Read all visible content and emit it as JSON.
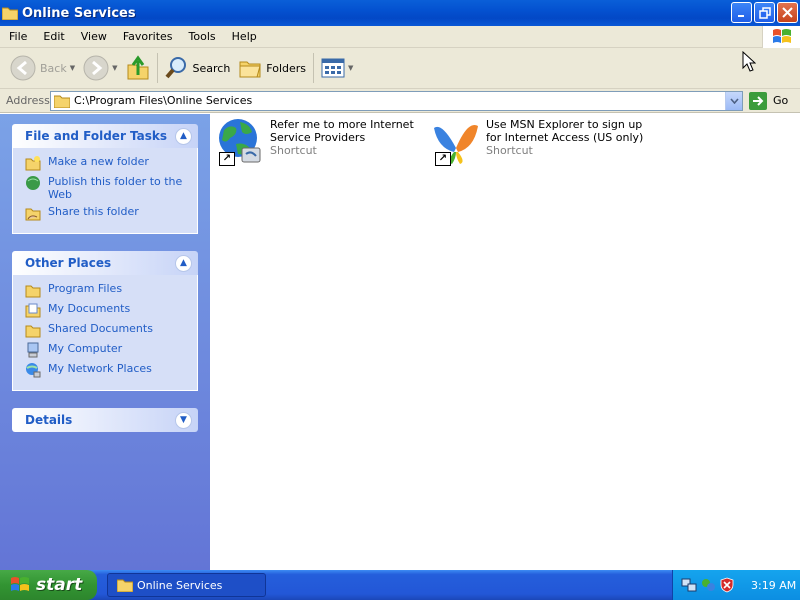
{
  "window": {
    "title": "Online Services"
  },
  "menu": [
    "File",
    "Edit",
    "View",
    "Favorites",
    "Tools",
    "Help"
  ],
  "toolbar": {
    "back_label": "Back",
    "search_label": "Search",
    "folders_label": "Folders"
  },
  "address": {
    "label": "Address",
    "value": "C:\\Program Files\\Online Services",
    "go_label": "Go"
  },
  "tasks_panel": {
    "title": "File and Folder Tasks",
    "items": [
      "Make a new folder",
      "Publish this folder to the Web",
      "Share this folder"
    ]
  },
  "places_panel": {
    "title": "Other Places",
    "items": [
      "Program Files",
      "My Documents",
      "Shared Documents",
      "My Computer",
      "My Network Places"
    ]
  },
  "details_panel": {
    "title": "Details"
  },
  "files": [
    {
      "name": "Refer me to more Internet Service Providers",
      "type": "Shortcut"
    },
    {
      "name": "Use MSN Explorer to sign up for Internet Access (US only)",
      "type": "Shortcut"
    }
  ],
  "taskbar": {
    "start_label": "start",
    "task_label": "Online Services",
    "time": "3:19 AM"
  },
  "colors": {
    "title_bar": "#0451d0",
    "link_blue": "#215dc6",
    "taskbar_blue": "#245edb",
    "start_green": "#329432"
  }
}
